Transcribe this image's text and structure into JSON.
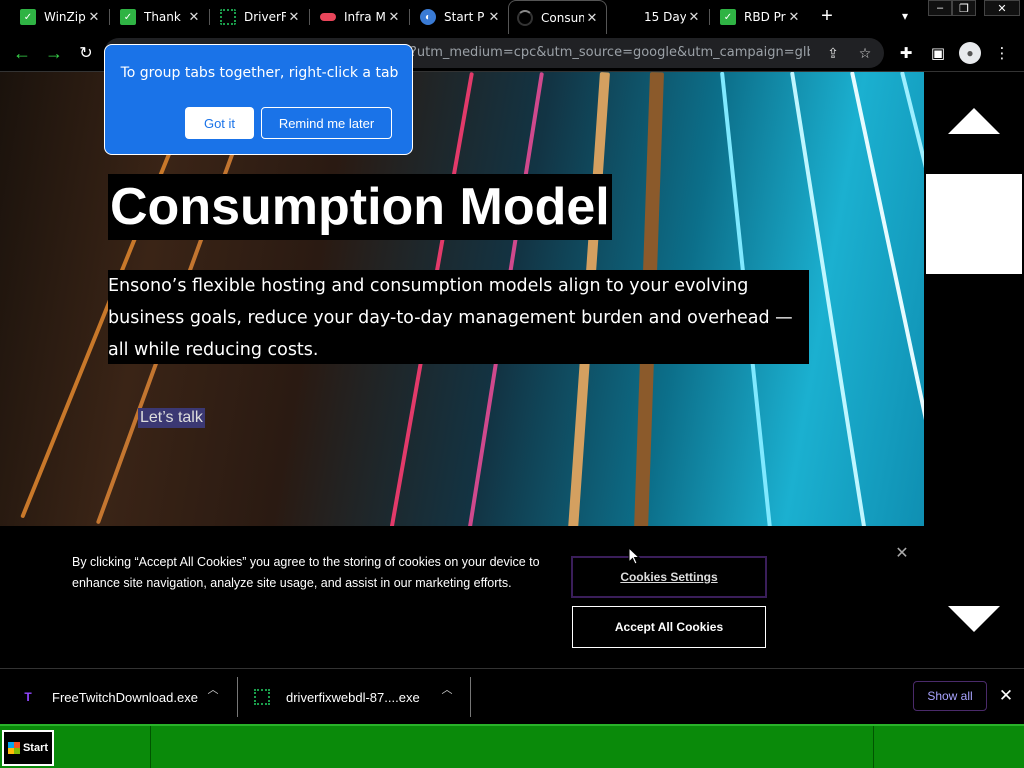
{
  "browser": {
    "tabs": [
      {
        "label": "WinZip",
        "icon": "winzip-icon",
        "color": "#2fb344"
      },
      {
        "label": "Thank",
        "icon": "winzip-icon",
        "color": "#2fb344"
      },
      {
        "label": "DriverF",
        "icon": "driverfix-icon",
        "color": "#1a9e4b"
      },
      {
        "label": "Infra M",
        "icon": "ensono-icon",
        "color": "#e8455a"
      },
      {
        "label": "Start P",
        "icon": "compass-icon",
        "color": "#3a7bd5"
      },
      {
        "label": "Consum",
        "icon": "loading-icon",
        "color": "#555555"
      },
      {
        "label": "15 Day",
        "icon": "blank-icon",
        "color": "#000000"
      },
      {
        "label": "RBD Pr",
        "icon": "winzip-icon",
        "color": "#2fb344"
      }
    ],
    "url": "?utm_medium=cpc&utm_source=google&utm_campaign=glb-..."
  },
  "tooltip": {
    "text": "To group tabs together, right-click a tab",
    "got_it": "Got it",
    "remind": "Remind me later"
  },
  "hero": {
    "title": "Consumption Model",
    "description": "Ensono’s flexible hosting and consumption models align to your evolving business goals, reduce your day-to-day management burden and overhead — all while reducing costs.",
    "cta": "Let’s talk"
  },
  "cookie": {
    "text": "By clicking “Accept All Cookies” you agree to the storing of cookies on your device to enhance site navigation, analyze site usage, and assist in our marketing efforts.",
    "settings": "Cookies Settings",
    "accept": "Accept All Cookies"
  },
  "downloads": {
    "items": [
      {
        "name": "FreeTwitchDownload.exe",
        "icon": "twitch-icon"
      },
      {
        "name": "driverfixwebdl-87....exe",
        "icon": "driverfix-icon"
      }
    ],
    "show_all": "Show all"
  },
  "taskbar": {
    "start": "Start"
  }
}
